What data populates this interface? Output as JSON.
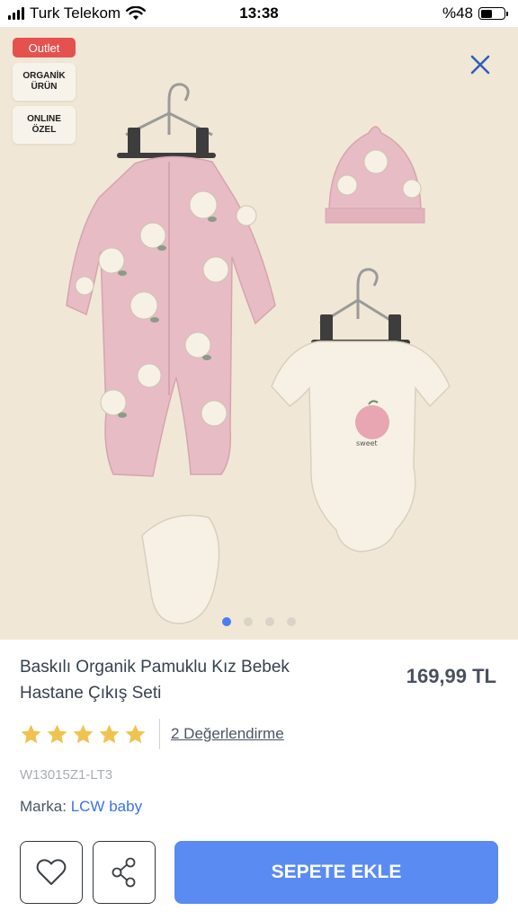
{
  "status_bar": {
    "carrier": "Turk Telekom",
    "time": "13:38",
    "battery": "%48"
  },
  "gallery": {
    "badges": {
      "outlet": "Outlet",
      "organic": "ORGANİK\nÜRÜN",
      "online": "ONLINE\nÖZEL"
    },
    "dots": 4,
    "active_dot": 0,
    "garment_color": "#e7bcc4",
    "body_color": "#f6f1e4",
    "background_color": "#f1e7d6"
  },
  "product": {
    "title": "Baskılı Organik Pamuklu Kız Bebek Hastane Çıkış Seti",
    "price": "169,99 TL",
    "rating": 5,
    "reviews_label": "2 Değerlendirme",
    "sku": "W13015Z1-LT3",
    "brand_label": "Marka:",
    "brand_name": "LCW baby"
  },
  "actions": {
    "add_to_cart": "SEPETE EKLE",
    "favorite_icon": "heart-icon",
    "share_icon": "share-icon"
  },
  "colors": {
    "accent": "#5a8bf2",
    "star": "#f0c350",
    "outlet": "#e5514f",
    "link": "#3a73e8"
  }
}
